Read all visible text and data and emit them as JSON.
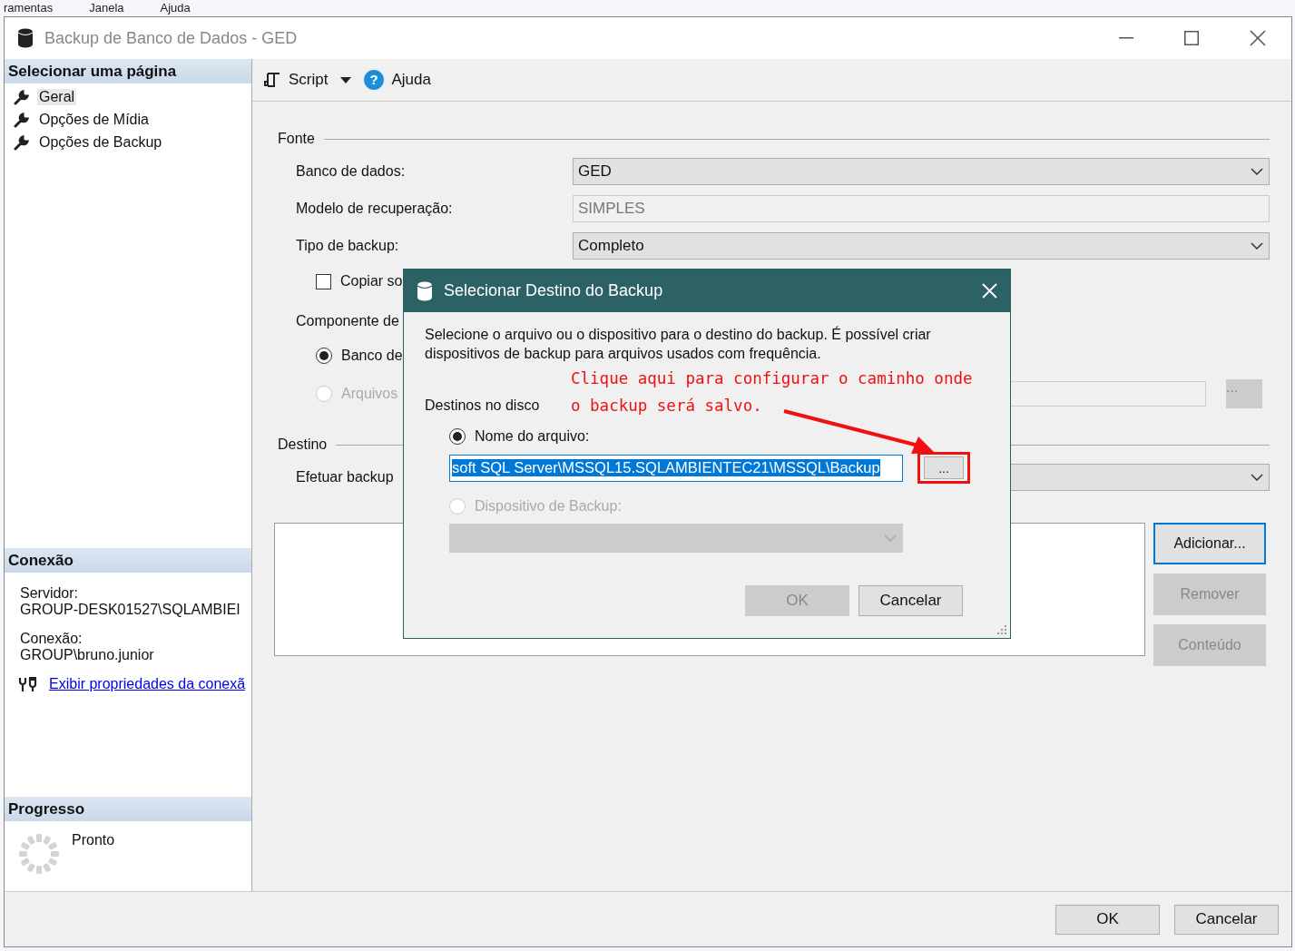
{
  "background_menu": [
    "ramentas",
    "Janela",
    "Ajuda"
  ],
  "window": {
    "title": "Backup de Banco de Dados - GED"
  },
  "sidebar": {
    "pages_header": "Selecionar uma página",
    "pages": [
      {
        "label": "Geral",
        "selected": true
      },
      {
        "label": "Opções de Mídia",
        "selected": false
      },
      {
        "label": "Opções de Backup",
        "selected": false
      }
    ],
    "connection_header": "Conexão",
    "connection": [
      {
        "label": "Servidor:",
        "value": "GROUP-DESK01527\\SQLAMBIEI"
      },
      {
        "label": "Conexão:",
        "value": "GROUP\\bruno.junior"
      }
    ],
    "connection_link": "Exibir propriedades da conexã",
    "progress_header": "Progresso",
    "progress_status": "Pronto"
  },
  "toolbar": {
    "script": "Script",
    "help_glyph": "?",
    "help": "Ajuda"
  },
  "source": {
    "heading": "Fonte",
    "fields": [
      {
        "label": "Banco de dados:",
        "value": "GED",
        "kind": "dropdown"
      },
      {
        "label": "Modelo de recuperação:",
        "value": "SIMPLES",
        "kind": "readonly"
      },
      {
        "label": "Tipo de backup:",
        "value": "Completo",
        "kind": "dropdown"
      }
    ],
    "copy_only": {
      "label": "Copiar so",
      "checked": false
    },
    "component_label": "Componente de",
    "component_options": [
      {
        "label": "Banco de",
        "selected": true,
        "disabled": false
      },
      {
        "label": "Arquivos",
        "selected": false,
        "disabled": true
      }
    ],
    "files_browse": "..."
  },
  "destination": {
    "heading": "Destino",
    "backup_to_label": "Efetuar backup",
    "buttons": [
      {
        "label": "Adicionar...",
        "disabled": false,
        "focused": true
      },
      {
        "label": "Remover",
        "disabled": true,
        "focused": false
      },
      {
        "label": "Conteúdo",
        "disabled": true,
        "focused": false
      }
    ]
  },
  "footer_buttons": [
    "OK",
    "Cancelar"
  ],
  "dialog": {
    "title": "Selecionar Destino do Backup",
    "description": "Selecione o arquivo ou o dispositivo para o destino do backup. É possível criar dispositivos de backup para arquivos usados com frequência.",
    "section_label": "Destinos no disco",
    "options": [
      {
        "label": "Nome do arquivo:",
        "selected": true,
        "disabled": false
      },
      {
        "label": "Dispositivo de Backup:",
        "selected": false,
        "disabled": true
      }
    ],
    "file_path": "soft SQL Server\\MSSQL15.SQLAMBIENTEC21\\MSSQL\\Backup",
    "browse": "...",
    "buttons": [
      {
        "label": "OK",
        "disabled": true
      },
      {
        "label": "Cancelar",
        "disabled": false
      }
    ]
  },
  "annotation": {
    "text": "Clique aqui para configurar o caminho onde o backup será salvo."
  }
}
